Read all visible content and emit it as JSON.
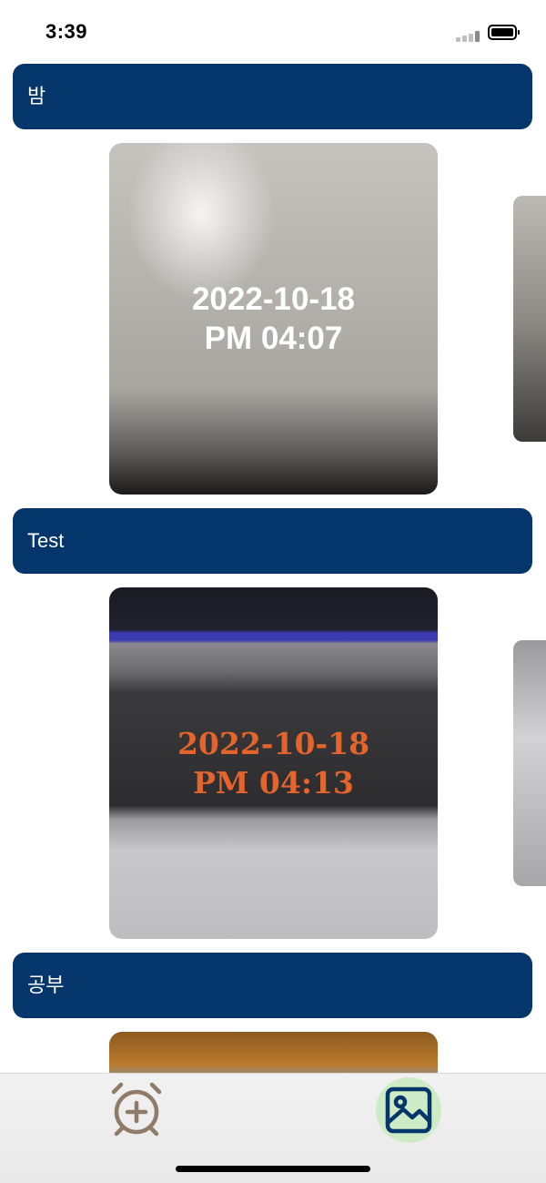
{
  "status_bar": {
    "time": "3:39"
  },
  "sections": [
    {
      "title": "밤",
      "photos": [
        {
          "date": "2022-10-18",
          "time": "PM 04:07"
        }
      ]
    },
    {
      "title": "Test",
      "photos": [
        {
          "date": "2022-10-18",
          "time": "PM 04:13"
        }
      ]
    },
    {
      "title": "공부",
      "photos": [
        {}
      ]
    }
  ],
  "tab_bar": {
    "items": [
      {
        "icon": "alarm-add-icon",
        "selected": false
      },
      {
        "icon": "gallery-image-icon",
        "selected": true
      }
    ]
  },
  "colors": {
    "header_background": "#04356b",
    "header_text": "#ffffff",
    "stamp_white": "#ffffff",
    "stamp_orange": "#e4642b",
    "tab_selected_background": "#cdebc4",
    "tab_selected_icon": "#04356b",
    "tab_unselected_icon": "#8e7b68"
  }
}
